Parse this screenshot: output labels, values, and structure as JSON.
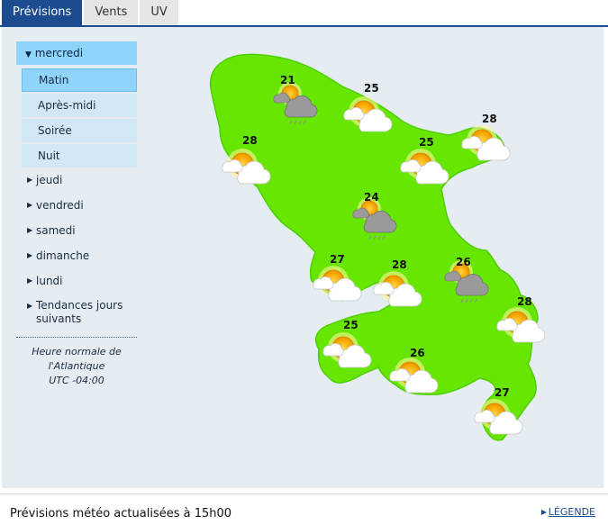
{
  "tabs": [
    {
      "label": "Prévisions",
      "active": true
    },
    {
      "label": "Vents",
      "active": false
    },
    {
      "label": "UV",
      "active": false
    }
  ],
  "sidebar": {
    "current_day": "mercredi",
    "periods": [
      "Matin",
      "Après-midi",
      "Soirée",
      "Nuit"
    ],
    "selected_period": "Matin",
    "days": [
      "jeudi",
      "vendredi",
      "samedi",
      "dimanche",
      "lundi"
    ],
    "trends": "Tendances jours suivants",
    "timezone": [
      "Heure normale de",
      "l'Atlantique",
      "UTC -04:00"
    ]
  },
  "map": {
    "stations": [
      {
        "temp": "21",
        "icon": "cloud-rain-sun-icon"
      },
      {
        "temp": "25",
        "icon": "partly-sunny-icon"
      },
      {
        "temp": "28",
        "icon": "partly-sunny-icon"
      },
      {
        "temp": "28",
        "icon": "partly-sunny-icon"
      },
      {
        "temp": "25",
        "icon": "partly-sunny-icon"
      },
      {
        "temp": "24",
        "icon": "cloud-rain-sun-icon"
      },
      {
        "temp": "27",
        "icon": "partly-sunny-icon"
      },
      {
        "temp": "28",
        "icon": "partly-sunny-icon"
      },
      {
        "temp": "26",
        "icon": "cloud-rain-sun-icon"
      },
      {
        "temp": "28",
        "icon": "partly-sunny-icon"
      },
      {
        "temp": "25",
        "icon": "partly-sunny-icon"
      },
      {
        "temp": "26",
        "icon": "partly-sunny-icon"
      },
      {
        "temp": "27",
        "icon": "partly-sunny-icon"
      }
    ],
    "land_color": "#66e600"
  },
  "footer": {
    "status": "Prévisions météo actualisées à 15h00",
    "legend": "LÉGENDE"
  }
}
